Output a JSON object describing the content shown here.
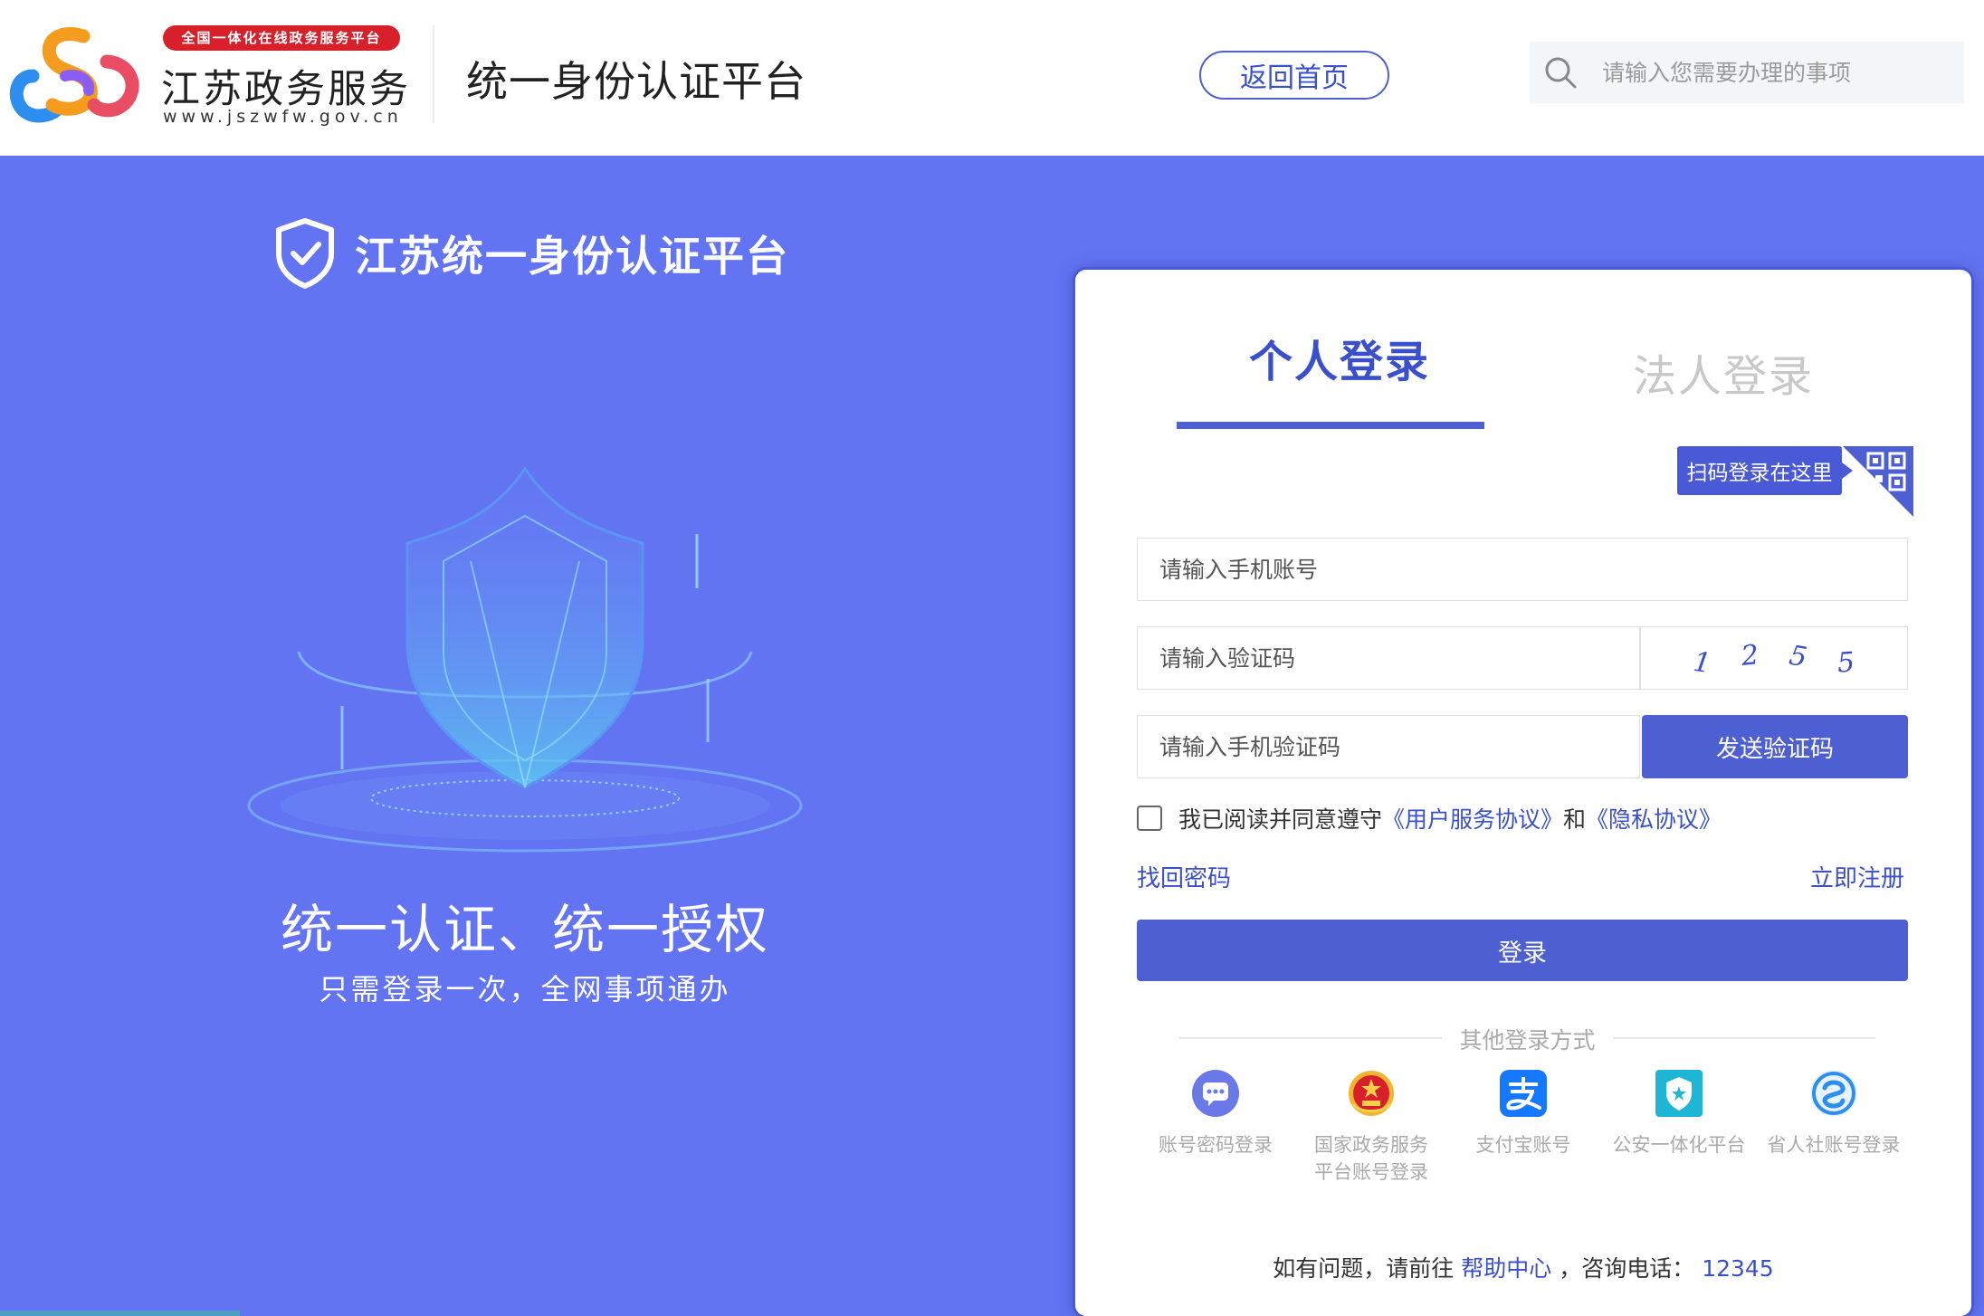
{
  "header": {
    "brand_badge": "全国一体化在线政务服务平台",
    "brand_name": "江苏政务服务",
    "brand_url": "www.jszwfw.gov.cn",
    "title": "统一身份认证平台",
    "home_button": "返回首页",
    "search_placeholder": "请输入您需要办理的事项"
  },
  "hero": {
    "title": "江苏统一身份认证平台",
    "slogan": "统一认证、统一授权",
    "sub": "只需登录一次，全网事项通办"
  },
  "login": {
    "tabs": {
      "personal": "个人登录",
      "corporate": "法人登录"
    },
    "qr_tip": "扫码登录在这里",
    "phone_placeholder": "请输入手机账号",
    "code_placeholder": "请输入验证码",
    "captcha_chars": [
      "1",
      "2",
      "5",
      "5"
    ],
    "sms_placeholder": "请输入手机验证码",
    "send_button": "发送验证码",
    "agree_text": "我已阅读并同意遵守",
    "agree_link1": "《用户服务协议》",
    "agree_and": "和",
    "agree_link2": "《隐私协议》",
    "forgot": "找回密码",
    "register": "立即注册",
    "login_button": "登录",
    "other_title": "其他登录方式",
    "alt_methods": [
      {
        "label1": "账号密码登录",
        "label2": ""
      },
      {
        "label1": "国家政务服务",
        "label2": "平台账号登录"
      },
      {
        "label1": "支付宝账号",
        "label2": ""
      },
      {
        "label1": "公安一体化平台",
        "label2": ""
      },
      {
        "label1": "省人社账号登录",
        "label2": ""
      }
    ],
    "help_prefix": "如有问题，请前往",
    "help_link": "帮助中心",
    "help_mid": "，咨询电话：",
    "help_phone": "12345"
  },
  "colors": {
    "background": "#6274f2",
    "accent": "#4d5fd1",
    "link": "#3a4fcb",
    "badge_red": "#d8202a"
  }
}
